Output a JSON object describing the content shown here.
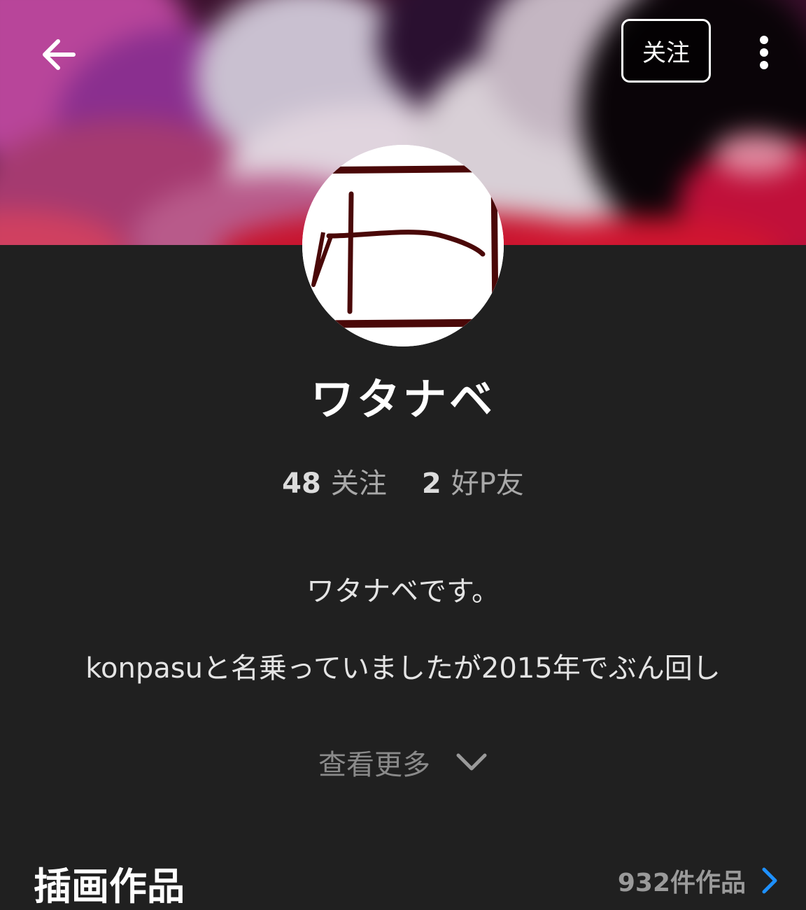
{
  "header": {
    "follow_label": "关注",
    "back_icon": "arrow-left-icon",
    "more_icon": "more-vertical-icon"
  },
  "profile": {
    "name": "ワタナベ",
    "following_count": "48",
    "following_label": "关注",
    "friends_count": "2",
    "friends_label": "好P友"
  },
  "bio": {
    "line1": "ワタナベです。",
    "line2": "konpasuと名乗っていましたが2015年でぶん回し",
    "see_more_label": "查看更多"
  },
  "illustrations": {
    "title": "插画作品",
    "count_label": "932件作品"
  },
  "colors": {
    "background": "#202020",
    "accent_blue": "#1e90ff",
    "avatar_ink": "#5a0a0a"
  }
}
